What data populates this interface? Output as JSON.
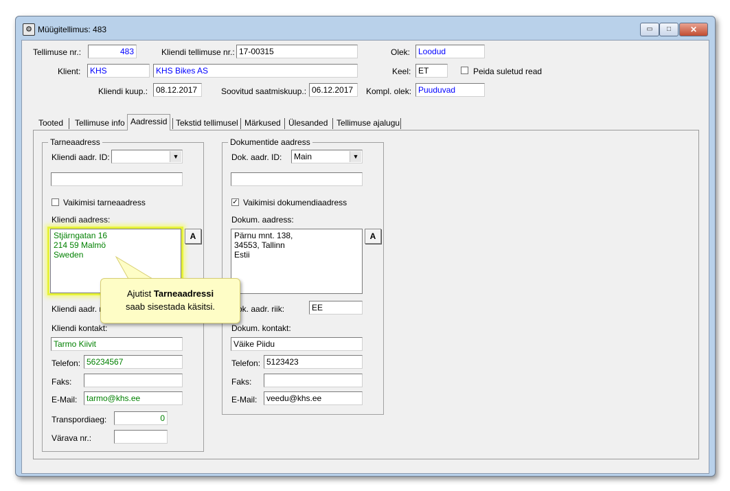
{
  "window": {
    "title": "Müügitellimus: 483",
    "buttons": {
      "minimize": "▭",
      "maximize": "□",
      "close": "✕"
    }
  },
  "header": {
    "order_no_label": "Tellimuse nr.:",
    "order_no_value": "483",
    "client_order_no_label": "Kliendi tellimuse nr.:",
    "client_order_no_value": "17-00315",
    "status_label": "Olek:",
    "status_value": "Loodud",
    "client_label": "Klient:",
    "client_code": "KHS",
    "client_name": "KHS Bikes AS",
    "language_label": "Keel:",
    "language_value": "ET",
    "hide_closed_label": "Peida suletud read",
    "client_date_label": "Kliendi kuup.:",
    "client_date_value": "08.12.2017",
    "desired_delivery_label": "Soovitud saatmiskuup.:",
    "desired_delivery_value": "06.12.2017",
    "completion_status_label": "Kompl. olek:",
    "completion_status_value": "Puuduvad"
  },
  "tabs": [
    {
      "label": "Tooted"
    },
    {
      "label": "Tellimuse info"
    },
    {
      "label": "Aadressid"
    },
    {
      "label": "Tekstid tellimusel"
    },
    {
      "label": "Märkused"
    },
    {
      "label": "Ülesanded"
    },
    {
      "label": "Tellimuse ajalugu"
    }
  ],
  "delivery": {
    "group_title": "Tarneaadress",
    "addr_id_label": "Kliendi aadr. ID:",
    "addr_id_value": "",
    "extra_field_value": "",
    "default_checkbox_label": "Vaikimisi tarneaadress",
    "default_checked": false,
    "address_label": "Kliendi aadress:",
    "address_text": "Stjärngatan 16\n214 59 Malmö\nSweden",
    "a_button": "A",
    "country_label_visible": "Kliendi aadr. r",
    "contact_label": "Kliendi kontakt:",
    "contact_value": "Tarmo Kiivit",
    "phone_label": "Telefon:",
    "phone_value": "56234567",
    "fax_label": "Faks:",
    "fax_value": "",
    "email_label": "E-Mail:",
    "email_value": "tarmo@khs.ee",
    "transit_label": "Transpordiaeg:",
    "transit_value": "0",
    "gate_label": "Värava nr.:",
    "gate_value": ""
  },
  "documents": {
    "group_title": "Dokumentide aadress",
    "addr_id_label": "Dok. aadr. ID:",
    "addr_id_value": "Main",
    "extra_field_value": "",
    "default_checkbox_label": "Vaikimisi dokumendiaadress",
    "default_checked": true,
    "check_mark": "✓",
    "address_label": "Dokum. aadress:",
    "address_text": "Pärnu mnt. 138,\n34553, Tallinn\nEstii",
    "a_button": "A",
    "country_label_visible": "ok. aadr. riik:",
    "country_value": "EE",
    "contact_label": "Dokum. kontakt:",
    "contact_value": "Väike Piidu",
    "phone_label": "Telefon:",
    "phone_value": "5123423",
    "fax_label": "Faks:",
    "fax_value": "",
    "email_label": "E-Mail:",
    "email_value": "veedu@khs.ee"
  },
  "callout": {
    "line1_prefix": "Ajutist ",
    "line1_bold": "Tarneaadressi",
    "line2": "saab sisestada käsitsi."
  },
  "colors": {
    "window_frame": "#b9d1ea",
    "client_bg": "#f0f0f0",
    "highlight": "#e6f23a",
    "callout_bg": "#fefdc6",
    "link_blue": "#0000ff",
    "value_green": "#008000"
  }
}
